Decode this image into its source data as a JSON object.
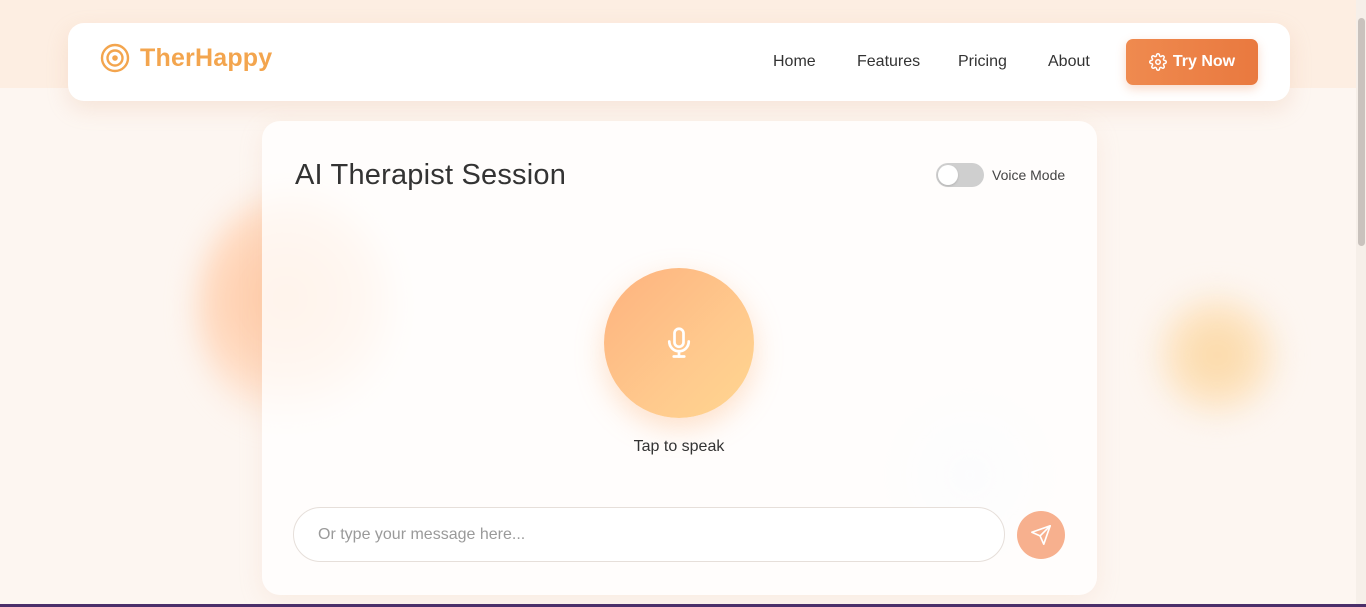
{
  "brand": {
    "name": "TherHappy",
    "icon": "target-icon",
    "color": "#f3a54e"
  },
  "nav": {
    "links": [
      "Home",
      "Features",
      "Pricing",
      "About"
    ],
    "cta": {
      "label": "Try Now",
      "icon": "gear-icon",
      "color": "#ef8a4f"
    }
  },
  "session": {
    "title": "AI Therapist Session",
    "voice_mode": {
      "label": "Voice Mode",
      "enabled": false
    },
    "mic": {
      "icon": "microphone-icon",
      "caption": "Tap to speak"
    },
    "message": {
      "placeholder": "Or type your message here...",
      "value": ""
    },
    "send": {
      "icon": "send-icon",
      "color": "#f7b08e"
    }
  }
}
